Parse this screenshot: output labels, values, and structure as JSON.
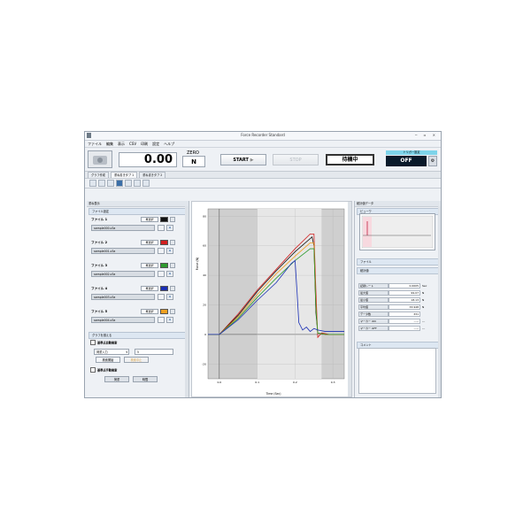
{
  "window": {
    "title": "Force Recorder Standard",
    "controls": "─ ▫ ×"
  },
  "menu": [
    "ファイル",
    "編集",
    "表示",
    "CSV",
    "印刷",
    "設定",
    "ヘルプ"
  ],
  "toolbar": {
    "value": "0.00",
    "zero_label": "ZERO",
    "unit": "N",
    "start_label": "START",
    "stop_label": "STOP",
    "status": "待機中",
    "trigger_header": "トリガー設定",
    "trigger_value": "OFF"
  },
  "tabs": [
    "グラフ作成",
    "重ね書きタブ 1",
    "重ね書きタブ 2"
  ],
  "left_panel": {
    "title": "重ね表示",
    "files_header": "ファイル設定",
    "select_label": "再選択",
    "files": [
      {
        "label": "ファイル 1",
        "filename": "sample000.z3a",
        "color": "#111111"
      },
      {
        "label": "ファイル 2",
        "filename": "sample001.z3a",
        "color": "#d21f1f"
      },
      {
        "label": "ファイル 3",
        "filename": "sample002.z3a",
        "color": "#2e9a2e"
      },
      {
        "label": "ファイル 4",
        "filename": "sample003.z3a",
        "color": "#1a2fb5"
      },
      {
        "label": "ファイル 5",
        "filename": "sample004.z3a",
        "color": "#f0a020"
      }
    ],
    "align_header": "グラフを揃える",
    "auto_align_label": "基準点自動検索",
    "auto_align_mode": "荷重入力",
    "auto_align_value": "5",
    "search_start": "検索開始",
    "search_stop": "検索中止",
    "manual_align_label": "基準点手動検索",
    "manual_col1": "荷重",
    "manual_col2": "時間"
  },
  "right_panel": {
    "title": "統計値データ",
    "preview_label": "ビューワ",
    "file_label": "ファイル",
    "stats_label": "統計値",
    "stats": [
      {
        "k": "記録レート",
        "v": "0.0005",
        "u": "Sec"
      },
      {
        "k": "最大値",
        "v": "99.07",
        "u": "N"
      },
      {
        "k": "最小値",
        "v": "18.13",
        "u": "N"
      },
      {
        "k": "平均値",
        "v": "33.948",
        "u": "N"
      },
      {
        "k": "データ数",
        "v": "331",
        "u": ""
      },
      {
        "k": "マーカー ON",
        "v": "-----",
        "u": "---"
      },
      {
        "k": "マーカー OFF",
        "v": "-----",
        "u": "---"
      }
    ],
    "comment_label": "コメント"
  },
  "colors": {
    "accent": "#7ed4ea",
    "plot_bg_dark": "#cfcfcf",
    "plot_bg_light": "#e7e7e7"
  },
  "chart_data": {
    "type": "line",
    "xlabel": "Time (Sec)",
    "ylabel": "Force (N)",
    "ylim": [
      -30,
      85
    ],
    "xlim": [
      -0.03,
      0.33
    ],
    "yticks": [
      "80",
      "60",
      "40",
      "20",
      "0",
      "-20"
    ],
    "xticks": [
      "0.0",
      "0.1",
      "0.2",
      "0.3"
    ],
    "series": [
      {
        "color": "#d21f1f",
        "x": [
          -0.03,
          0.0,
          0.05,
          0.1,
          0.15,
          0.2,
          0.24,
          0.25,
          0.255,
          0.26,
          0.27,
          0.29,
          0.33
        ],
        "y": [
          0,
          0,
          14,
          30,
          44,
          58,
          68,
          68,
          30,
          -2,
          1,
          0,
          0
        ]
      },
      {
        "color": "#111111",
        "x": [
          -0.03,
          0.0,
          0.05,
          0.1,
          0.15,
          0.2,
          0.245,
          0.25,
          0.255,
          0.26,
          0.28,
          0.33
        ],
        "y": [
          0,
          0,
          13,
          29,
          43,
          56,
          66,
          60,
          15,
          1,
          0,
          0
        ]
      },
      {
        "color": "#f0a020",
        "x": [
          -0.03,
          0.0,
          0.05,
          0.1,
          0.15,
          0.2,
          0.24,
          0.25,
          0.255,
          0.26,
          0.28,
          0.33
        ],
        "y": [
          0,
          0,
          12,
          27,
          41,
          53,
          62,
          62,
          20,
          1,
          0,
          0
        ]
      },
      {
        "color": "#2e9a2e",
        "x": [
          -0.03,
          0.0,
          0.05,
          0.1,
          0.15,
          0.2,
          0.24,
          0.25,
          0.255,
          0.26,
          0.28,
          0.33
        ],
        "y": [
          0,
          0,
          11,
          25,
          38,
          50,
          58,
          58,
          18,
          1,
          0,
          0
        ]
      },
      {
        "color": "#1a2fb5",
        "x": [
          -0.03,
          0.0,
          0.05,
          0.1,
          0.15,
          0.19,
          0.2,
          0.205,
          0.21,
          0.22,
          0.23,
          0.24,
          0.25,
          0.26,
          0.28,
          0.33
        ],
        "y": [
          0,
          0,
          10,
          23,
          35,
          48,
          50,
          30,
          8,
          3,
          5,
          2,
          4,
          3,
          2,
          2
        ]
      }
    ]
  }
}
